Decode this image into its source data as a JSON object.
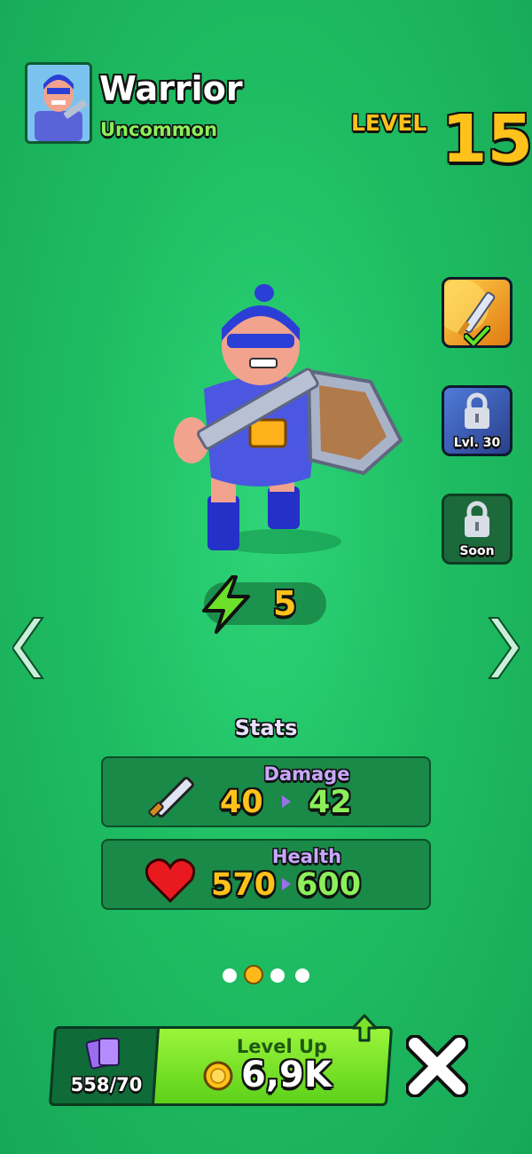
{
  "hero": {
    "name": "Warrior",
    "rarity": "Uncommon",
    "level_label": "LEVEL",
    "level": "15"
  },
  "skills": [
    {
      "name": "sword-skill",
      "unlocked": true,
      "selected": true,
      "caption": ""
    },
    {
      "name": "locked-skill",
      "unlocked": false,
      "caption": "Lvl. 30"
    },
    {
      "name": "coming-soon-skill",
      "unlocked": false,
      "caption": "Soon"
    }
  ],
  "power": {
    "value": "5",
    "icon": "lightning-icon"
  },
  "stats": {
    "title": "Stats",
    "damage": {
      "label": "Damage",
      "current": "40",
      "next": "42",
      "icon": "sword-icon"
    },
    "health": {
      "label": "Health",
      "current": "570",
      "next": "600",
      "icon": "heart-icon"
    }
  },
  "pagination": {
    "total": 4,
    "active_index": 1
  },
  "footer": {
    "cards": "558/70",
    "level_up_label": "Level Up",
    "level_up_cost": "6,9K",
    "close_icon": "close-icon"
  },
  "colors": {
    "background": "#1fbe63",
    "gold": "#ffc21a",
    "green_value": "#8cf05a",
    "stat_label": "#c7a8ff",
    "button": "#7be22a"
  }
}
